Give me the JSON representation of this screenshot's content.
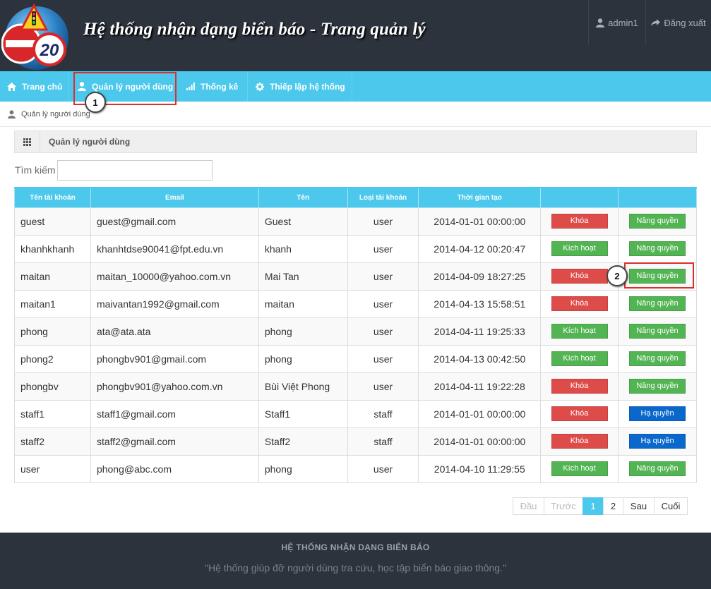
{
  "header": {
    "title": "Hệ thống nhận dạng biển báo - Trang quản lý",
    "logo_number": "20",
    "user_label": "admin1",
    "logout_label": "Đăng xuất"
  },
  "nav": {
    "items": [
      {
        "label": "Trang chủ",
        "icon": "home-icon"
      },
      {
        "label": "Quản lý người dùng",
        "icon": "user-icon"
      },
      {
        "label": "Thống kê",
        "icon": "signal-icon"
      },
      {
        "label": "Thiếp lập hệ thống",
        "icon": "gear-icon"
      }
    ]
  },
  "callouts": {
    "first": "1",
    "second": "2"
  },
  "breadcrumb": {
    "label": "Quản lý người dùng"
  },
  "panel": {
    "title": "Quản lý người dùng"
  },
  "search": {
    "label": "Tìm kiếm",
    "value": ""
  },
  "table": {
    "headers": [
      "Tên tài khoản",
      "Email",
      "Tên",
      "Loại tài khoản",
      "Thời gian tạo",
      "",
      ""
    ],
    "rows": [
      {
        "username": "guest",
        "email": "guest@gmail.com",
        "name": "Guest",
        "type": "user",
        "created": "2014-01-01 00:00:00",
        "lock": "Khóa",
        "lock_color": "red",
        "role": "Nâng quyền",
        "role_color": "green"
      },
      {
        "username": "khanhkhanh",
        "email": "khanhtdse90041@fpt.edu.vn",
        "name": "khanh",
        "type": "user",
        "created": "2014-04-12 00:20:47",
        "lock": "Kích hoạt",
        "lock_color": "green",
        "role": "Nâng quyền",
        "role_color": "green"
      },
      {
        "username": "maitan",
        "email": "maitan_10000@yahoo.com.vn",
        "name": "Mai Tan",
        "type": "user",
        "created": "2014-04-09 18:27:25",
        "lock": "Khóa",
        "lock_color": "red",
        "role": "Nâng quyền",
        "role_color": "green"
      },
      {
        "username": "maitan1",
        "email": "maivantan1992@gmail.com",
        "name": "maitan",
        "type": "user",
        "created": "2014-04-13 15:58:51",
        "lock": "Khóa",
        "lock_color": "red",
        "role": "Nâng quyền",
        "role_color": "green"
      },
      {
        "username": "phong",
        "email": "ata@ata.ata",
        "name": "phong",
        "type": "user",
        "created": "2014-04-11 19:25:33",
        "lock": "Kích hoạt",
        "lock_color": "green",
        "role": "Nâng quyền",
        "role_color": "green"
      },
      {
        "username": "phong2",
        "email": "phongbv901@gmail.com",
        "name": "phong",
        "type": "user",
        "created": "2014-04-13 00:42:50",
        "lock": "Kích hoạt",
        "lock_color": "green",
        "role": "Nâng quyền",
        "role_color": "green"
      },
      {
        "username": "phongbv",
        "email": "phongbv901@yahoo.com.vn",
        "name": "Bùi Việt Phong",
        "type": "user",
        "created": "2014-04-11 19:22:28",
        "lock": "Khóa",
        "lock_color": "red",
        "role": "Nâng quyền",
        "role_color": "green"
      },
      {
        "username": "staff1",
        "email": "staff1@gmail.com",
        "name": "Staff1",
        "type": "staff",
        "created": "2014-01-01 00:00:00",
        "lock": "Khóa",
        "lock_color": "red",
        "role": "Hạ quyền",
        "role_color": "blue"
      },
      {
        "username": "staff2",
        "email": "staff2@gmail.com",
        "name": "Staff2",
        "type": "staff",
        "created": "2014-01-01 00:00:00",
        "lock": "Khóa",
        "lock_color": "red",
        "role": "Hạ quyền",
        "role_color": "blue"
      },
      {
        "username": "user",
        "email": "phong@abc.com",
        "name": "phong",
        "type": "user",
        "created": "2014-04-10 11:29:55",
        "lock": "Kích hoạt",
        "lock_color": "green",
        "role": "Nâng quyền",
        "role_color": "green"
      }
    ]
  },
  "pagination": [
    {
      "label": "Đầu",
      "state": "disabled"
    },
    {
      "label": "Trước",
      "state": "disabled"
    },
    {
      "label": "1",
      "state": "active"
    },
    {
      "label": "2",
      "state": "normal"
    },
    {
      "label": "Sau",
      "state": "normal"
    },
    {
      "label": "Cuối",
      "state": "normal"
    }
  ],
  "footer": {
    "title": "HỆ THỐNG NHẬN DẠNG BIỂN BÁO",
    "description": "\"Hệ thống giúp đỡ người dùng tra cứu, học tập biển báo giao thông.\""
  },
  "colors": {
    "header_bg": "#2d333d",
    "accent": "#4bc8ec",
    "red": "#dd4c49",
    "green": "#52b453",
    "blue": "#0a68cd",
    "highlight": "#d9302c"
  }
}
